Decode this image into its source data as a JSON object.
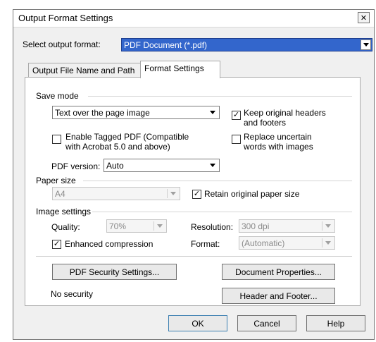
{
  "window": {
    "title": "Output Format Settings"
  },
  "format": {
    "label": "Select output format:",
    "value": "PDF Document (*.pdf)"
  },
  "tabs": [
    {
      "label": "Output File Name and Path",
      "active": false
    },
    {
      "label": "Format Settings",
      "active": true
    }
  ],
  "save_mode": {
    "group": "Save mode",
    "selected": "Text over the page image",
    "keep_headers_line1": "Keep original headers",
    "keep_headers_line2": "and footers",
    "keep_headers_checked": true,
    "tagged_line1": "Enable Tagged PDF (Compatible",
    "tagged_line2": "with Acrobat 5.0 and above)",
    "tagged_checked": false,
    "replace_line1": "Replace uncertain",
    "replace_line2": "words with images",
    "replace_checked": false,
    "pdf_version_label": "PDF version:",
    "pdf_version_value": "Auto"
  },
  "paper": {
    "group": "Paper size",
    "value": "A4",
    "retain_label": "Retain original paper size",
    "retain_checked": true
  },
  "image": {
    "group": "Image settings",
    "quality_label": "Quality:",
    "quality_value": "70%",
    "resolution_label": "Resolution:",
    "resolution_value": "300 dpi",
    "enhanced_label": "Enhanced compression",
    "enhanced_checked": true,
    "format_label": "Format:",
    "format_value": "(Automatic)"
  },
  "security": {
    "button": "PDF Security Settings...",
    "status": "No security"
  },
  "buttons": {
    "doc_props": "Document Properties...",
    "header_footer": "Header and Footer...",
    "ok": "OK",
    "cancel": "Cancel",
    "help": "Help"
  },
  "check_mark": "✓",
  "close_glyph": "✕"
}
